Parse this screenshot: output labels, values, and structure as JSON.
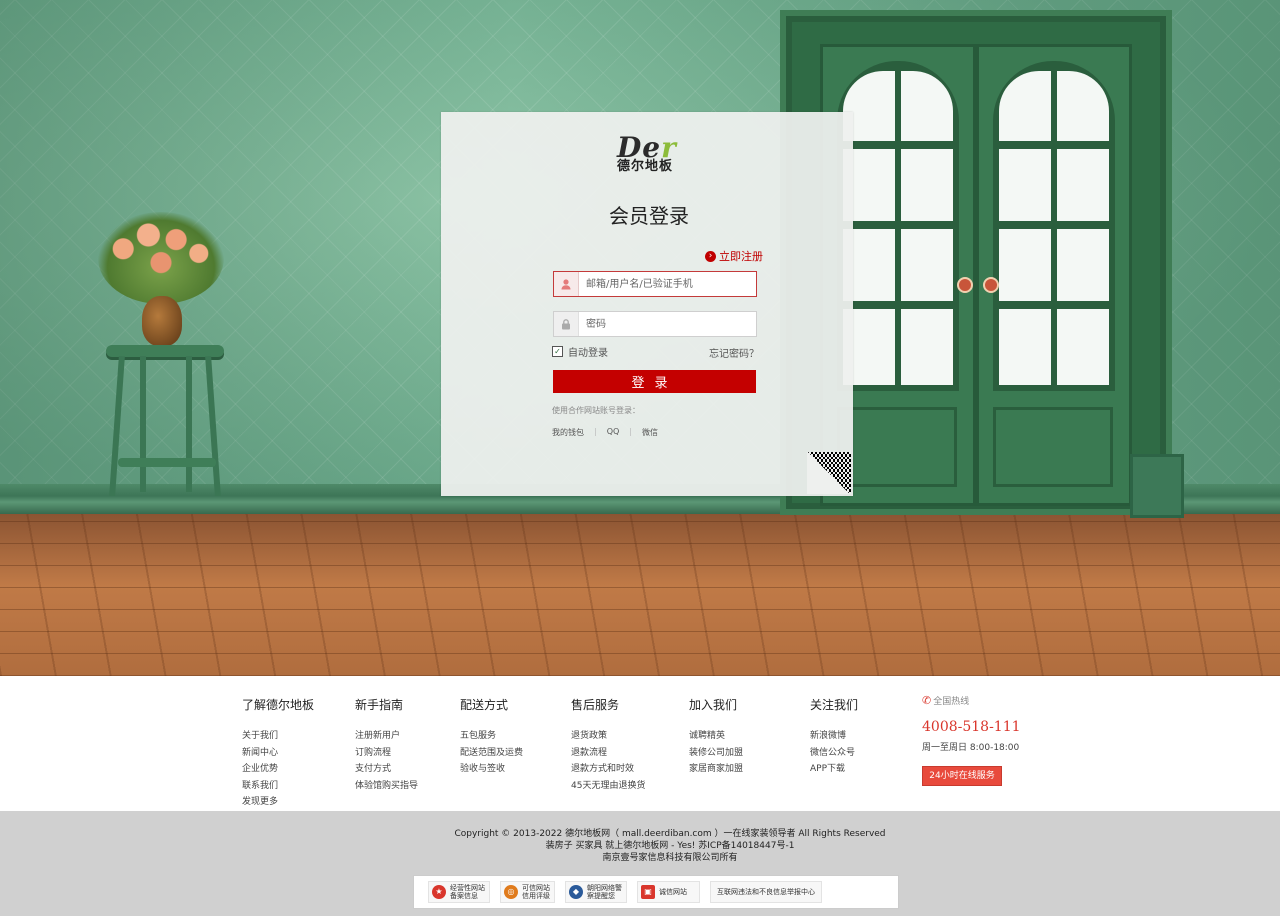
{
  "brand": {
    "logo_mark_a": "De",
    "logo_mark_b": "r",
    "logo_sub": "德尔地板"
  },
  "login": {
    "title": "会员登录",
    "register_link": "立即注册",
    "username_placeholder": "邮箱/用户名/已验证手机",
    "password_placeholder": "密码",
    "auto_login": "自动登录",
    "forgot": "忘记密码？",
    "submit": "登录",
    "partner_note": "使用合作网站账号登录：",
    "partners": [
      "我的钱包",
      "QQ",
      "微信"
    ]
  },
  "footer": {
    "columns": [
      {
        "title": "了解德尔地板",
        "items": [
          "关于我们",
          "新闻中心",
          "企业优势",
          "联系我们",
          "发现更多"
        ]
      },
      {
        "title": "新手指南",
        "items": [
          "注册新用户",
          "订购流程",
          "支付方式",
          "体验馆购买指导"
        ]
      },
      {
        "title": "配送方式",
        "items": [
          "五包服务",
          "配送范围及运费",
          "验收与签收"
        ]
      },
      {
        "title": "售后服务",
        "items": [
          "退货政策",
          "退款流程",
          "退款方式和时效",
          "45天无理由退换货"
        ]
      },
      {
        "title": "加入我们",
        "items": [
          "诚聘精英",
          "装修公司加盟",
          "家居商家加盟"
        ]
      },
      {
        "title": "关注我们",
        "items": [
          "新浪微博",
          "微信公众号",
          "APP下载"
        ]
      }
    ],
    "hotline_label": "全国热线",
    "hotline": "4008-518-111",
    "hours": "周一至周日 8:00-18:00",
    "online_service": "24小时在线服务"
  },
  "bottom": {
    "copyright": "Copyright © 2013-2022 德尔地板网（ mall.deerdiban.com ）一在线家装领导者 All Rights Reserved",
    "slogan": "装房子 买家具 就上德尔地板网 - Yes! 苏ICP备14018447号-1",
    "company": "南京壹号家信息科技有限公司所有",
    "badges": [
      {
        "line1": "经营性网站",
        "line2": "备案信息",
        "color": "#d9362c"
      },
      {
        "line1": "可信网站",
        "line2": "信用评级",
        "color": "#e07b1c"
      },
      {
        "line1": "朝阳网络警",
        "line2": "察提醒您",
        "color": "#2a5a9a"
      },
      {
        "line1": "诚信网站",
        "line2": "",
        "color": "#d9362c"
      },
      {
        "line1": "互联网违法和不良信息举报中心",
        "line2": "",
        "color": ""
      }
    ]
  }
}
